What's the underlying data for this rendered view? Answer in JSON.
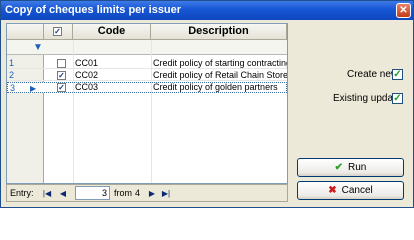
{
  "window": {
    "title": "Copy of cheques limits per issuer",
    "close_symbol": "✕"
  },
  "grid": {
    "columns": [
      "Code",
      "Description"
    ],
    "filter_icon": "filter-icon",
    "rows": [
      {
        "num": "1",
        "checked": false,
        "code": "CC01",
        "description": "Credit policy of starting contracting..."
      },
      {
        "num": "2",
        "checked": true,
        "code": "CC02",
        "description": "Credit policy of Retail Chain Stores"
      },
      {
        "num": "3",
        "checked": true,
        "code": "CC03",
        "description": "Credit policy of golden partners",
        "selected": true
      }
    ]
  },
  "navigator": {
    "label": "Entry:",
    "current": "3",
    "from_label": "from",
    "total": "4",
    "first_symbol": "|◀",
    "prev_symbol": "◀",
    "next_symbol": "▶",
    "last_symbol": "▶|"
  },
  "options": {
    "create_new": {
      "label": "Create new",
      "checked": true
    },
    "existing_update": {
      "label": "Existing update",
      "checked": true
    }
  },
  "buttons": {
    "run": {
      "label": "Run",
      "icon_symbol": "✔",
      "color": "#2ea02e"
    },
    "cancel": {
      "label": "Cancel",
      "icon_symbol": "✖",
      "color": "#d01818"
    }
  }
}
